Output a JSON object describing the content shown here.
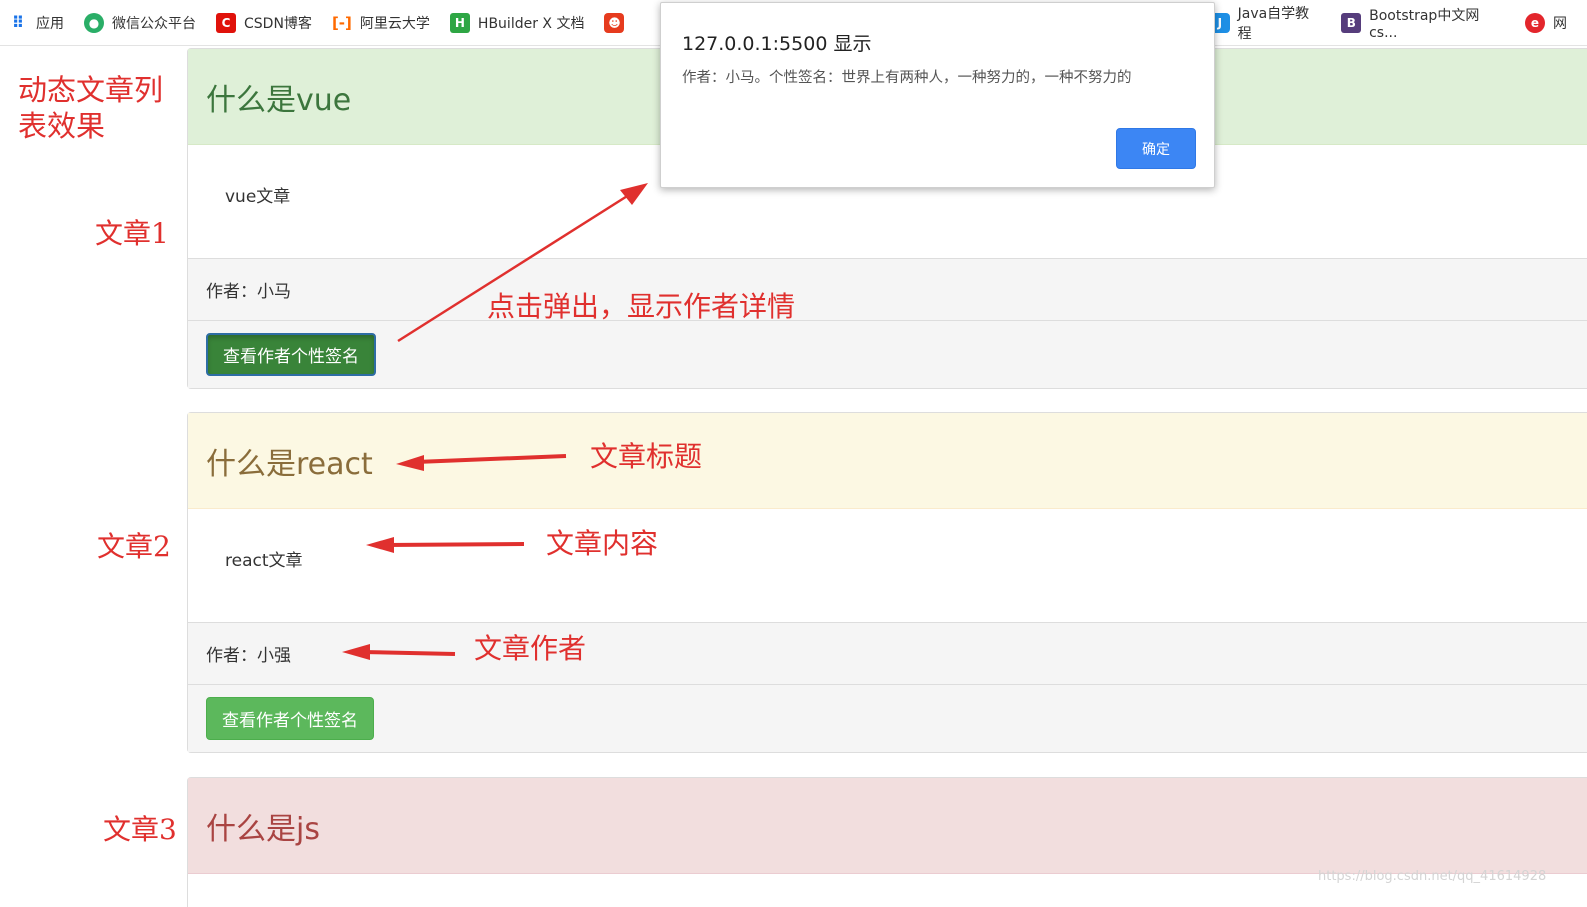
{
  "bookmarks": {
    "items": [
      {
        "label": "应用"
      },
      {
        "label": "微信公众平台"
      },
      {
        "label": "CSDN博客"
      },
      {
        "label": "阿里云大学"
      },
      {
        "label": "HBuilder X 文档"
      },
      {
        "label": ""
      }
    ],
    "right_items": [
      {
        "label": "Java自学教程"
      },
      {
        "label": "Bootstrap中文网cs..."
      },
      {
        "label": "网"
      }
    ]
  },
  "annotations": {
    "page_title": "动态文章列表效果",
    "article1": "文章1",
    "article2": "文章2",
    "article3": "文章3",
    "popup_note": "点击弹出，显示作者详情",
    "heading_note": "文章标题",
    "content_note": "文章内容",
    "author_note": "文章作者"
  },
  "articles": [
    {
      "title": "什么是vue",
      "content": "vue文章",
      "author": "作者：小马",
      "button": "查看作者个性签名"
    },
    {
      "title": "什么是react",
      "content": "react文章",
      "author": "作者：小强",
      "button": "查看作者个性签名"
    },
    {
      "title": "什么是js"
    }
  ],
  "dialog": {
    "title": "127.0.0.1:5500 显示",
    "message": "作者：小马。个性签名：世界上有两种人，一种努力的，一种不努力的",
    "ok": "确定"
  },
  "watermark": "https://blog.csdn.net/qq_41614928",
  "colors": {
    "annotation": "#e0302e",
    "success_heading": "#dff0d8",
    "warning_heading": "#fcf8e3",
    "danger_heading": "#f2dede",
    "button": "#5cb85c",
    "dialog_button": "#3c86f4"
  }
}
